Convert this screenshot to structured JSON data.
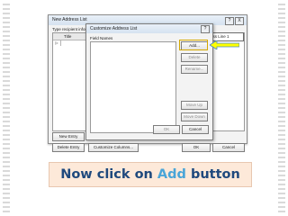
{
  "outer_dialog": {
    "title": "New Address List",
    "help": "?",
    "close": "X",
    "instruction": "Type recipient infor",
    "column_title": "Title",
    "column_address": "dress Line 1",
    "row_marker": "▷",
    "buttons": {
      "new_entry": "New Entry",
      "delete_entry": "Delete Entry",
      "customize_columns": "Customize Columns...",
      "ok": "OK",
      "cancel": "Cancel"
    }
  },
  "inner_dialog": {
    "title": "Customize Address List",
    "help": "?",
    "field_names_label": "Field Names",
    "buttons": {
      "add": "Add...",
      "delete": "Delete",
      "rename": "Rename...",
      "move_up": "Move Up",
      "move_down": "Move Down",
      "ok": "OK",
      "cancel": "Cancel"
    }
  },
  "caption": {
    "part1": "Now click on ",
    "highlight": "Add",
    "part2": " button"
  },
  "colors": {
    "caption_text": "#1f497d",
    "caption_highlight": "#4aa5d8",
    "caption_bg": "#fde9d9",
    "arrow_fill": "#ffff00",
    "arrow_border": "#4a86c7"
  }
}
